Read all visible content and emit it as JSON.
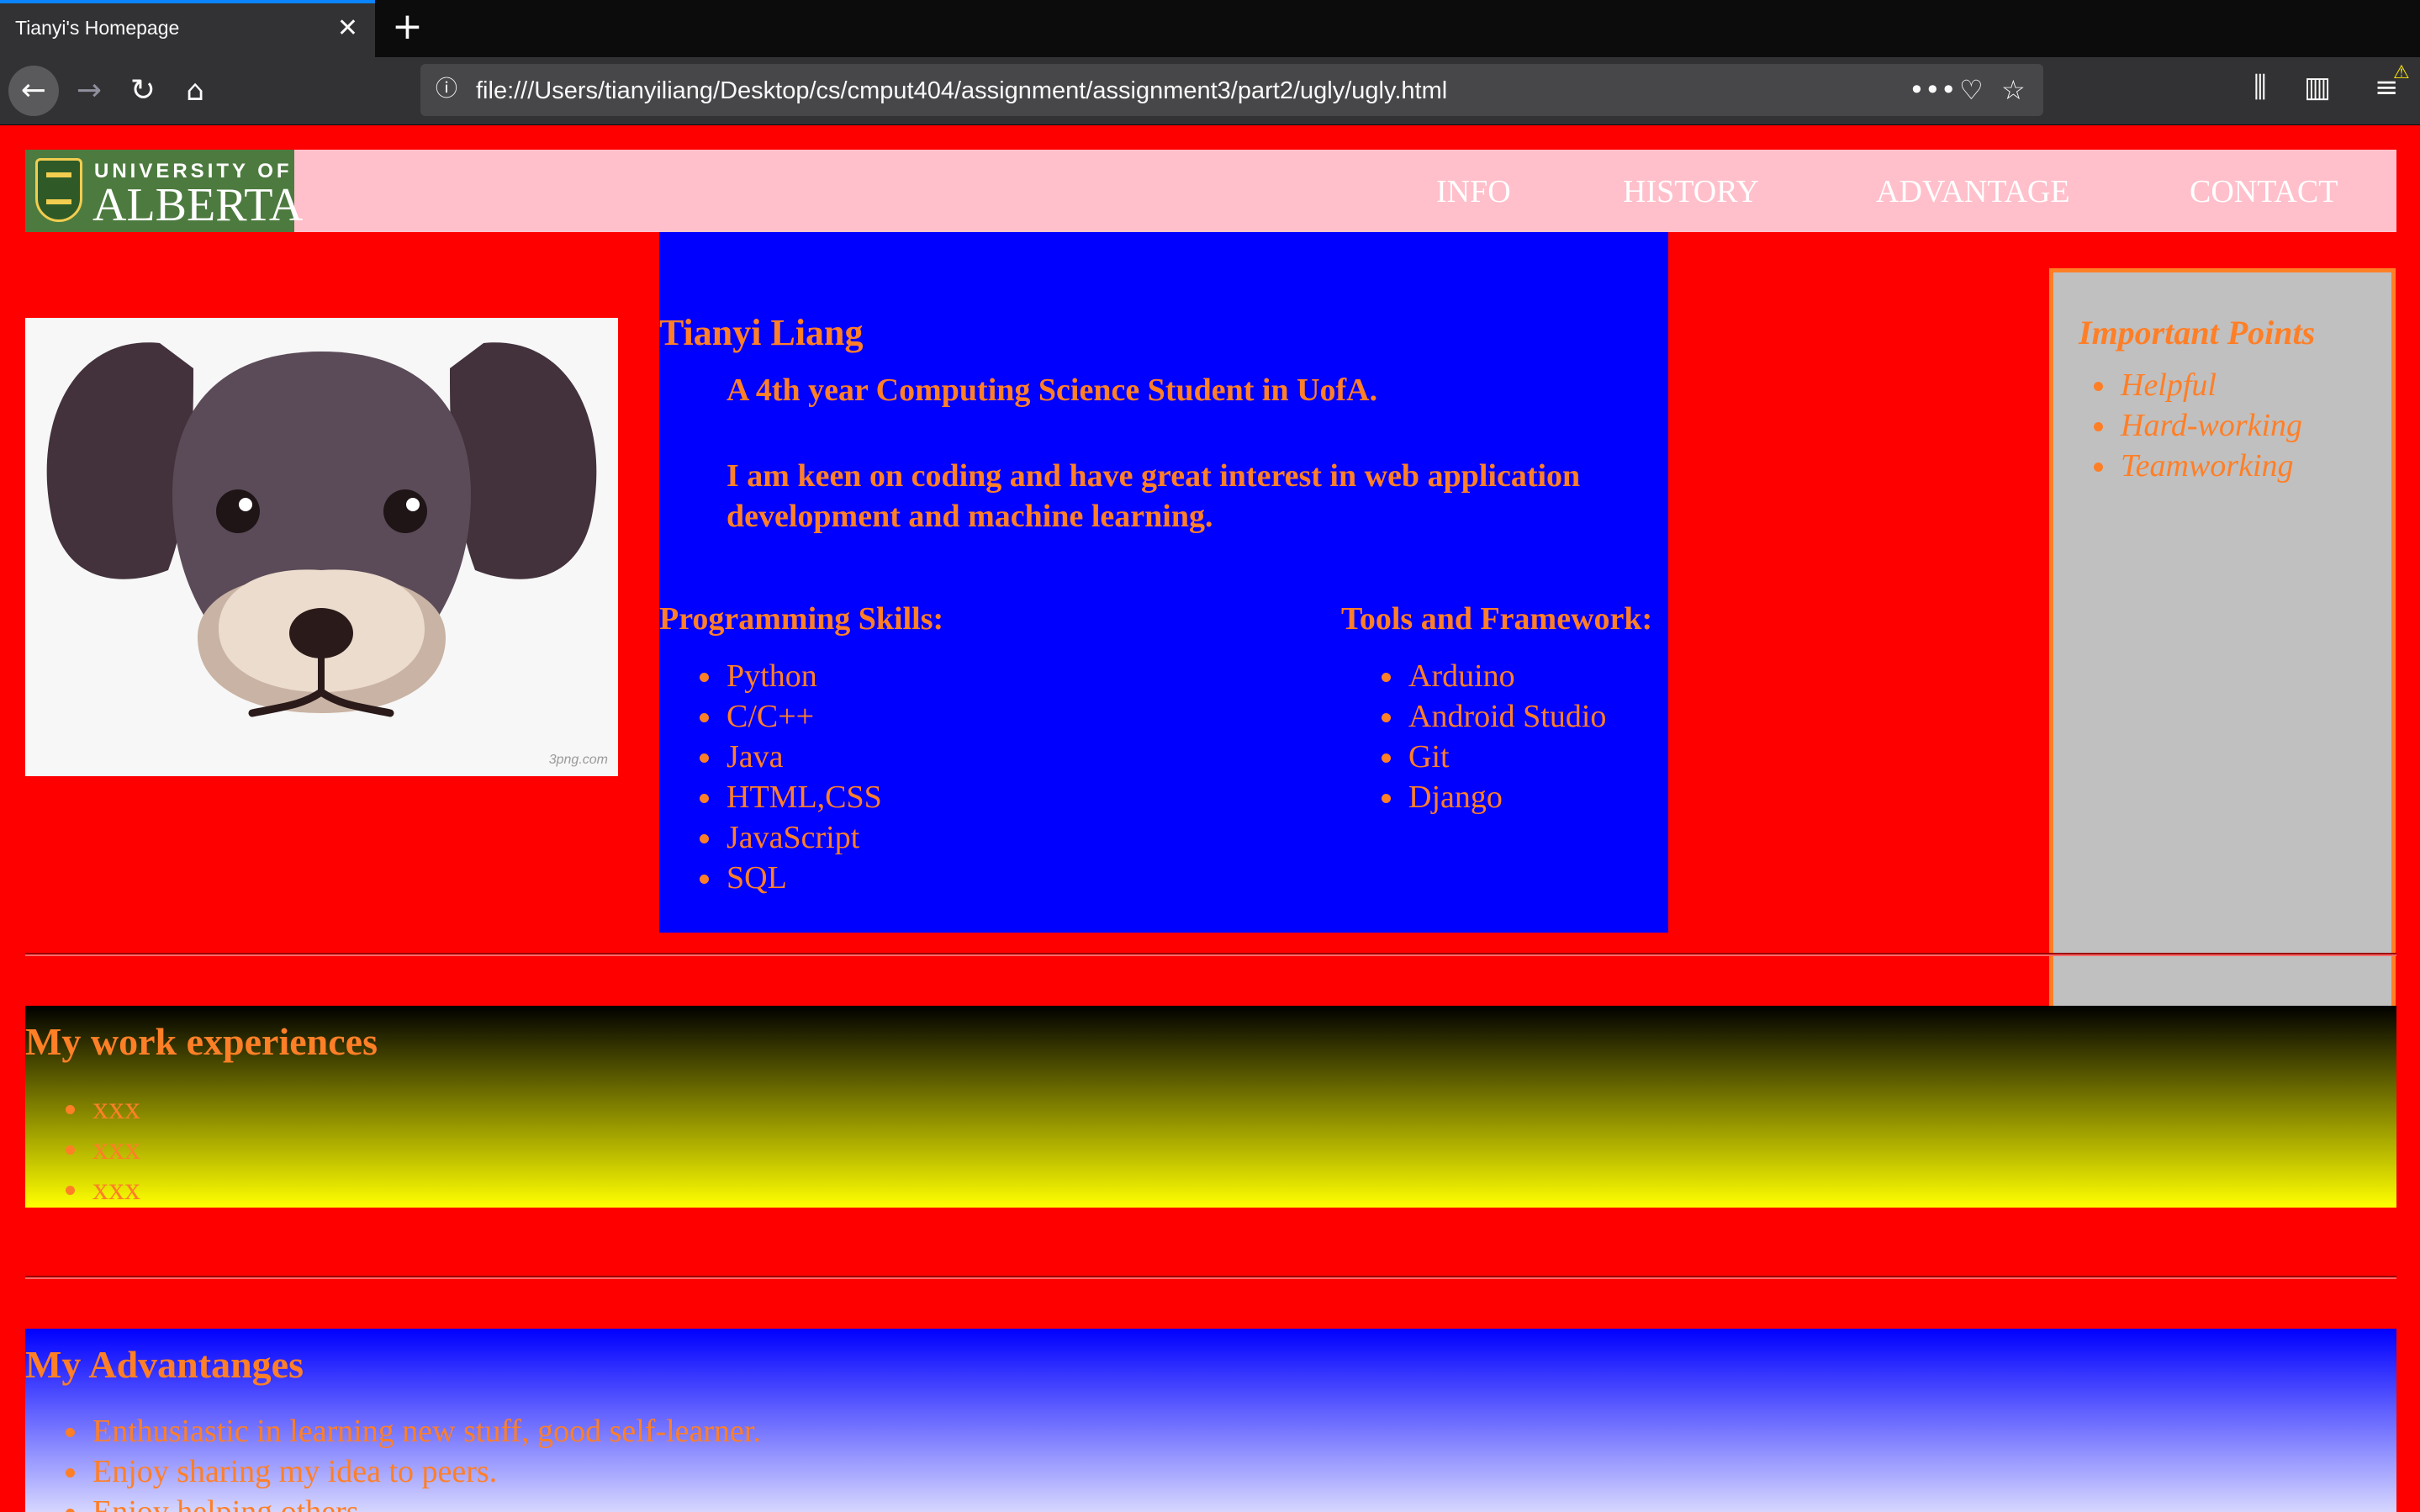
{
  "browser": {
    "tab_title": "Tianyi's Homepage",
    "url": "file:///Users/tianyiliang/Desktop/cs/cmput404/assignment/assignment3/part2/ugly/ugly.html"
  },
  "site": {
    "logo": {
      "line1": "UNIVERSITY OF",
      "line2": "ALBERTA"
    },
    "nav": [
      "INFO",
      "HISTORY",
      "ADVANTAGE",
      "CONTACT"
    ],
    "image_watermark": "3png.com",
    "profile": {
      "name": "Tianyi Liang",
      "bio": [
        "A 4th year Computing Science Student in UofA.",
        "I am keen on coding and have great interest in web application",
        "development and machine learning."
      ]
    },
    "programming": {
      "heading": "Programming Skills:",
      "items": [
        "Python",
        "C/C++",
        "Java",
        "HTML,CSS",
        "JavaScript",
        "SQL"
      ]
    },
    "tools": {
      "heading": "Tools and Framework:",
      "items": [
        "Arduino",
        "Android Studio",
        "Git",
        "Django"
      ]
    },
    "aside": {
      "heading": "Important Points",
      "items": [
        "Helpful",
        "Hard-working",
        "Teamworking"
      ]
    },
    "work": {
      "heading": "My work experiences",
      "items": [
        "xxx",
        "xxx",
        "xxx"
      ]
    },
    "advantages": {
      "heading": "My Advantanges",
      "items": [
        "Enthusiastic in learning new stuff, good self-learner.",
        "Enjoy sharing my idea to peers.",
        "Enjoy helping others."
      ]
    }
  },
  "colors": {
    "page_background": "#ff0000",
    "nav_background": "#ffc0cb",
    "center_column": "#0000ff",
    "text_accent": "#ff7f27",
    "aside_background": "#c0c0c0"
  }
}
